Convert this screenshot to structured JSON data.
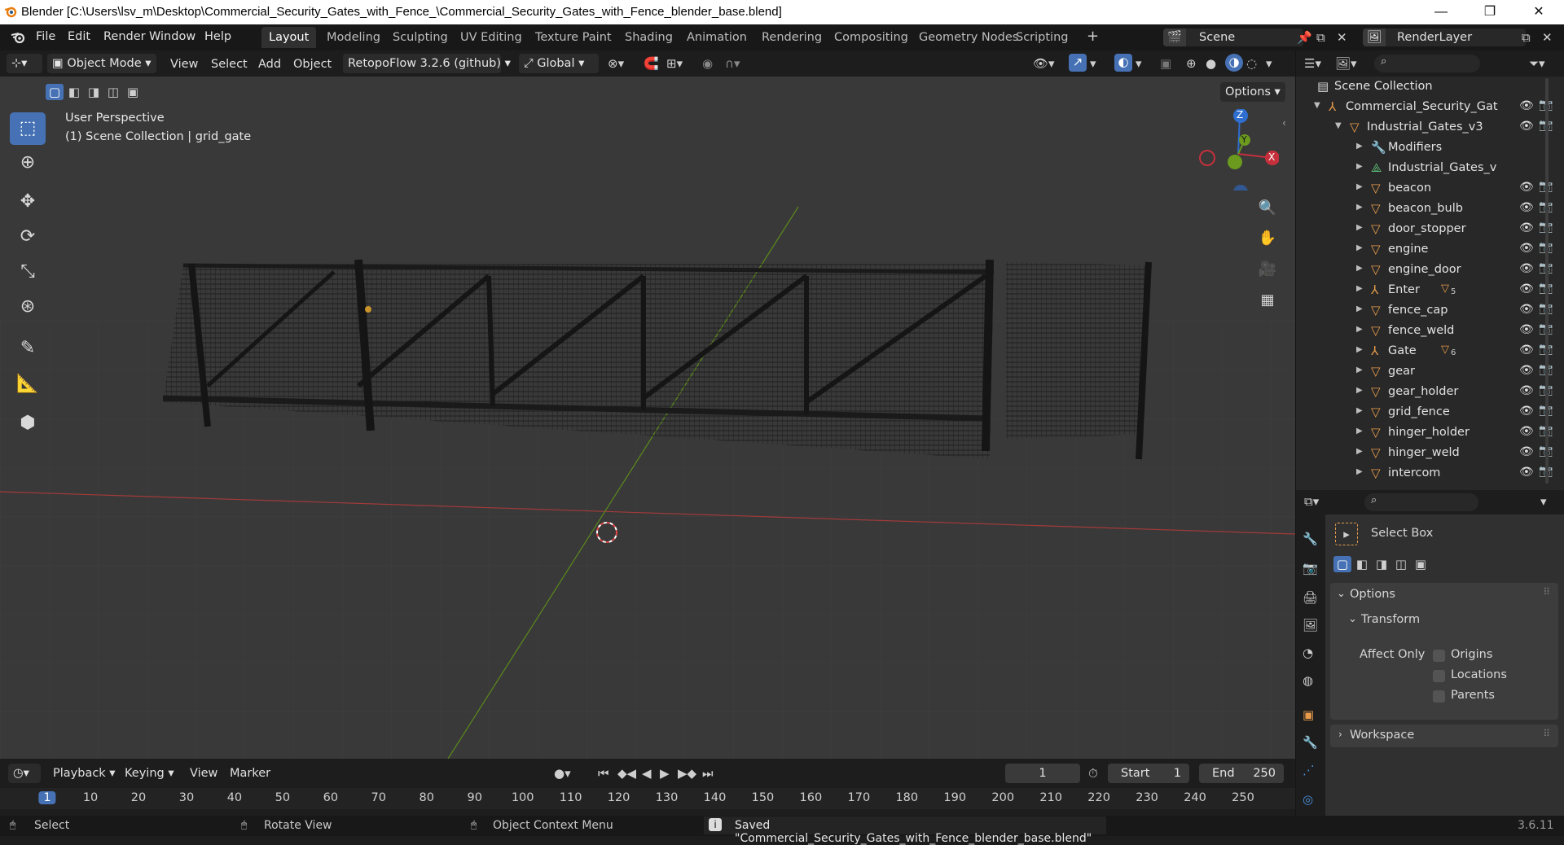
{
  "titlebar": {
    "title": "Blender [C:\\Users\\lsv_m\\Desktop\\Commercial_Security_Gates_with_Fence_\\Commercial_Security_Gates_with_Fence_blender_base.blend]",
    "minimize": "—",
    "maximize": "❐",
    "close": "✕"
  },
  "menus": [
    "File",
    "Edit",
    "Render",
    "Window",
    "Help"
  ],
  "workspaces": [
    "Layout",
    "Modeling",
    "Sculpting",
    "UV Editing",
    "Texture Paint",
    "Shading",
    "Animation",
    "Rendering",
    "Compositing",
    "Geometry Nodes",
    "Scripting"
  ],
  "active_workspace": "Layout",
  "scene": "Scene",
  "view_layer": "RenderLayer",
  "viewport_header": {
    "mode": "Object Mode",
    "menus": [
      "View",
      "Select",
      "Add",
      "Object"
    ],
    "addon": "RetopoFlow 3.2.6 (github)",
    "orientation": "Global",
    "options": "Options"
  },
  "viewport": {
    "perspective": "User Perspective",
    "collection_info": "(1) Scene Collection | grid_gate",
    "gizmo": {
      "z": "Z",
      "y": "Y",
      "x": "X"
    }
  },
  "outliner": {
    "root": "Scene Collection",
    "items": [
      {
        "label": "Commercial_Security_Gat",
        "indent": 1,
        "icon": "empty",
        "expanded": true
      },
      {
        "label": "Industrial_Gates_v3",
        "indent": 2,
        "icon": "mesh",
        "expanded": true
      },
      {
        "label": "Modifiers",
        "indent": 3,
        "icon": "wrench"
      },
      {
        "label": "Industrial_Gates_v",
        "indent": 3,
        "icon": "mesh-data"
      },
      {
        "label": "beacon",
        "indent": 3,
        "icon": "mesh"
      },
      {
        "label": "beacon_bulb",
        "indent": 3,
        "icon": "mesh"
      },
      {
        "label": "door_stopper",
        "indent": 3,
        "icon": "mesh"
      },
      {
        "label": "engine",
        "indent": 3,
        "icon": "mesh"
      },
      {
        "label": "engine_door",
        "indent": 3,
        "icon": "mesh"
      },
      {
        "label": "Enter",
        "indent": 3,
        "icon": "empty",
        "badge": "5"
      },
      {
        "label": "fence_cap",
        "indent": 3,
        "icon": "mesh"
      },
      {
        "label": "fence_weld",
        "indent": 3,
        "icon": "mesh"
      },
      {
        "label": "Gate",
        "indent": 3,
        "icon": "empty",
        "badge": "6"
      },
      {
        "label": "gear",
        "indent": 3,
        "icon": "mesh"
      },
      {
        "label": "gear_holder",
        "indent": 3,
        "icon": "mesh"
      },
      {
        "label": "grid_fence",
        "indent": 3,
        "icon": "mesh"
      },
      {
        "label": "hinger_holder",
        "indent": 3,
        "icon": "mesh"
      },
      {
        "label": "hinger_weld",
        "indent": 3,
        "icon": "mesh"
      },
      {
        "label": "intercom",
        "indent": 3,
        "icon": "mesh"
      }
    ]
  },
  "properties": {
    "tool_name": "Select Box",
    "options": "Options",
    "transform": "Transform",
    "affect_only": "Affect Only",
    "checks": [
      "Origins",
      "Locations",
      "Parents"
    ],
    "workspace": "Workspace"
  },
  "timeline": {
    "menus": [
      "Playback",
      "Keying",
      "View",
      "Marker"
    ],
    "current_frame": "1",
    "start_label": "Start",
    "start": "1",
    "end_label": "End",
    "end": "250",
    "ticks": [
      "1",
      "10",
      "20",
      "30",
      "40",
      "50",
      "60",
      "70",
      "80",
      "90",
      "100",
      "110",
      "120",
      "130",
      "140",
      "150",
      "160",
      "170",
      "180",
      "190",
      "200",
      "210",
      "220",
      "230",
      "240",
      "250"
    ]
  },
  "status": {
    "select": "Select",
    "rotate": "Rotate View",
    "context": "Object Context Menu",
    "message": "Saved \"Commercial_Security_Gates_with_Fence_blender_base.blend\"",
    "version": "3.6.11"
  },
  "colors": {
    "accent": "#4672b5",
    "orange": "#e89c4b",
    "axis_x": "#c5303c",
    "axis_y": "#6b9a1f",
    "axis_z": "#2d6ecf"
  }
}
